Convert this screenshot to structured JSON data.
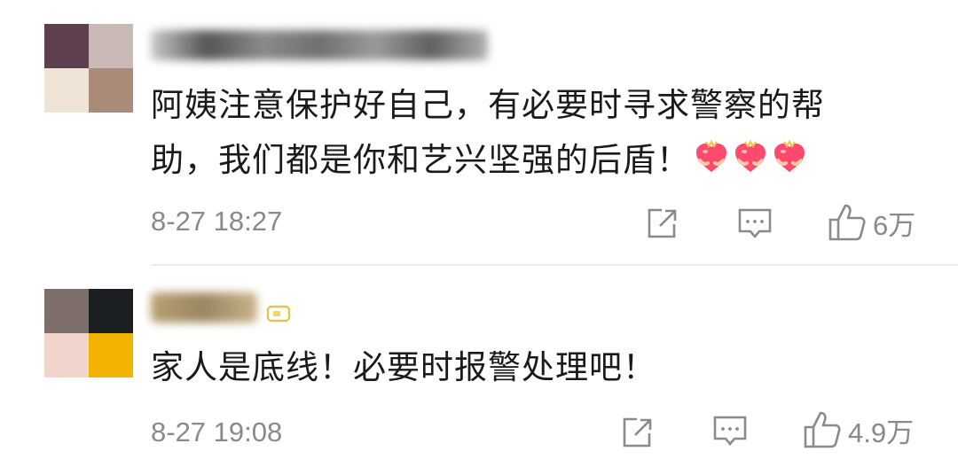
{
  "comments": [
    {
      "avatar_colors": [
        "#5e3f4e",
        "#c9b9b7",
        "#f0e4d6",
        "#a88b78"
      ],
      "name_blur_colors": [
        "#c8c8c8",
        "#555555",
        "#8a8a8a",
        "#707070",
        "#9a9a9a",
        "#606060",
        "#b0b0b0"
      ],
      "text_line1": "阿姨注意保护好自己，有必要时寻求警察的帮",
      "text_line2": "助，我们都是你和艺兴坚强的后盾！",
      "emoji_icons": [
        "heart-gift-icon",
        "heart-gift-icon",
        "heart-gift-icon"
      ],
      "time": "8-27 18:27",
      "like_count": "6万"
    },
    {
      "avatar_colors": [
        "#7d6e6a",
        "#1b1e22",
        "#f1d5cc",
        "#f3b400"
      ],
      "name_blur_colors": [
        "#b8a070",
        "#9a8660",
        "#c9b48a"
      ],
      "text_line1": "家人是底线！必要时报警处理吧！",
      "time": "8-27 19:08",
      "like_count": "4.9万"
    }
  ],
  "colors": {
    "text": "#1a1a1a",
    "meta": "#8a8a8a",
    "icon": "#8a8a8a",
    "heart": "#ff4a6e",
    "divider": "#ececec"
  }
}
